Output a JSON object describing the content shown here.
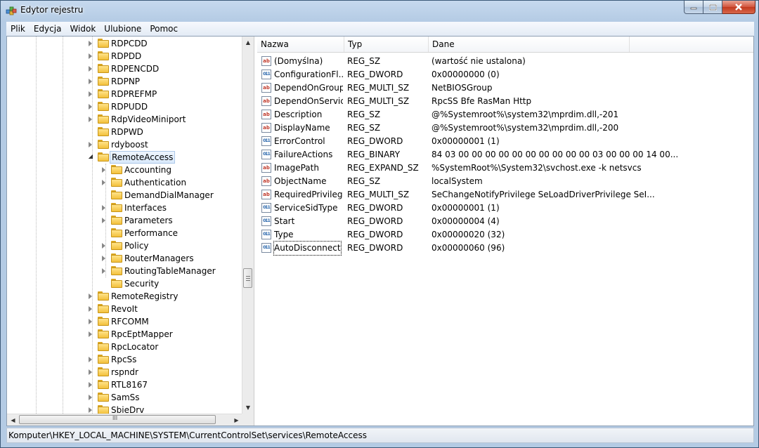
{
  "window": {
    "title": "Edytor rejestru",
    "icon": "regedit-icon"
  },
  "menu": [
    "Plik",
    "Edycja",
    "Widok",
    "Ulubione",
    "Pomoc"
  ],
  "tree": [
    {
      "label": "RDPCDD",
      "expandable": true,
      "depth": 0
    },
    {
      "label": "RDPDD",
      "expandable": true,
      "depth": 0
    },
    {
      "label": "RDPENCDD",
      "expandable": true,
      "depth": 0
    },
    {
      "label": "RDPNP",
      "expandable": true,
      "depth": 0
    },
    {
      "label": "RDPREFMP",
      "expandable": true,
      "depth": 0
    },
    {
      "label": "RDPUDD",
      "expandable": true,
      "depth": 0
    },
    {
      "label": "RdpVideoMiniport",
      "expandable": true,
      "depth": 0
    },
    {
      "label": "RDPWD",
      "expandable": false,
      "depth": 0
    },
    {
      "label": "rdyboost",
      "expandable": true,
      "depth": 0
    },
    {
      "label": "RemoteAccess",
      "expandable": true,
      "expanded": true,
      "selected": true,
      "depth": 0
    },
    {
      "label": "Accounting",
      "expandable": true,
      "depth": 1
    },
    {
      "label": "Authentication",
      "expandable": true,
      "depth": 1
    },
    {
      "label": "DemandDialManager",
      "expandable": false,
      "depth": 1
    },
    {
      "label": "Interfaces",
      "expandable": true,
      "depth": 1
    },
    {
      "label": "Parameters",
      "expandable": true,
      "depth": 1
    },
    {
      "label": "Performance",
      "expandable": false,
      "depth": 1
    },
    {
      "label": "Policy",
      "expandable": true,
      "depth": 1
    },
    {
      "label": "RouterManagers",
      "expandable": true,
      "depth": 1
    },
    {
      "label": "RoutingTableManager",
      "expandable": true,
      "depth": 1
    },
    {
      "label": "Security",
      "expandable": false,
      "depth": 1
    },
    {
      "label": "RemoteRegistry",
      "expandable": true,
      "depth": 0
    },
    {
      "label": "RevoIt",
      "expandable": true,
      "depth": 0
    },
    {
      "label": "RFCOMM",
      "expandable": true,
      "depth": 0
    },
    {
      "label": "RpcEptMapper",
      "expandable": true,
      "depth": 0
    },
    {
      "label": "RpcLocator",
      "expandable": false,
      "depth": 0
    },
    {
      "label": "RpcSs",
      "expandable": true,
      "depth": 0
    },
    {
      "label": "rspndr",
      "expandable": true,
      "depth": 0
    },
    {
      "label": "RTL8167",
      "expandable": true,
      "depth": 0
    },
    {
      "label": "SamSs",
      "expandable": true,
      "depth": 0
    },
    {
      "label": "SbieDrv",
      "expandable": true,
      "depth": 0
    }
  ],
  "list": {
    "columns": [
      "Nazwa",
      "Typ",
      "Dane"
    ],
    "rows": [
      {
        "name": "(Domyślna)",
        "type": "REG_SZ",
        "data": "(wartość nie ustalona)",
        "icon": "ab"
      },
      {
        "name": "ConfigurationFl...",
        "type": "REG_DWORD",
        "data": "0x00000000 (0)",
        "icon": "bin"
      },
      {
        "name": "DependOnGroup",
        "type": "REG_MULTI_SZ",
        "data": "NetBIOSGroup",
        "icon": "ab"
      },
      {
        "name": "DependOnService",
        "type": "REG_MULTI_SZ",
        "data": "RpcSS Bfe RasMan Http",
        "icon": "ab"
      },
      {
        "name": "Description",
        "type": "REG_SZ",
        "data": "@%Systemroot%\\system32\\mprdim.dll,-201",
        "icon": "ab"
      },
      {
        "name": "DisplayName",
        "type": "REG_SZ",
        "data": "@%Systemroot%\\system32\\mprdim.dll,-200",
        "icon": "ab"
      },
      {
        "name": "ErrorControl",
        "type": "REG_DWORD",
        "data": "0x00000001 (1)",
        "icon": "bin"
      },
      {
        "name": "FailureActions",
        "type": "REG_BINARY",
        "data": "84 03 00 00 00 00 00 00 00 00 00 00 03 00 00 00 14 00...",
        "icon": "bin"
      },
      {
        "name": "ImagePath",
        "type": "REG_EXPAND_SZ",
        "data": "%SystemRoot%\\System32\\svchost.exe -k netsvcs",
        "icon": "ab"
      },
      {
        "name": "ObjectName",
        "type": "REG_SZ",
        "data": "localSystem",
        "icon": "ab"
      },
      {
        "name": "RequiredPrivileg...",
        "type": "REG_MULTI_SZ",
        "data": "SeChangeNotifyPrivilege SeLoadDriverPrivilege SeI...",
        "icon": "ab"
      },
      {
        "name": "ServiceSidType",
        "type": "REG_DWORD",
        "data": "0x00000001 (1)",
        "icon": "bin"
      },
      {
        "name": "Start",
        "type": "REG_DWORD",
        "data": "0x00000004 (4)",
        "icon": "bin"
      },
      {
        "name": "Type",
        "type": "REG_DWORD",
        "data": "0x00000020 (32)",
        "icon": "bin"
      },
      {
        "name": "AutoDisconnect",
        "type": "REG_DWORD",
        "data": "0x00000060 (96)",
        "icon": "bin",
        "focused": true
      }
    ]
  },
  "status": {
    "path": "Komputer\\HKEY_LOCAL_MACHINE\\SYSTEM\\CurrentControlSet\\services\\RemoteAccess"
  },
  "icon_labels": {
    "ab": "ab",
    "bin": "011"
  },
  "scroll_glyphs": {
    "up": "▲",
    "down": "▼",
    "left": "◀",
    "right": "▶",
    "grip": "III"
  }
}
